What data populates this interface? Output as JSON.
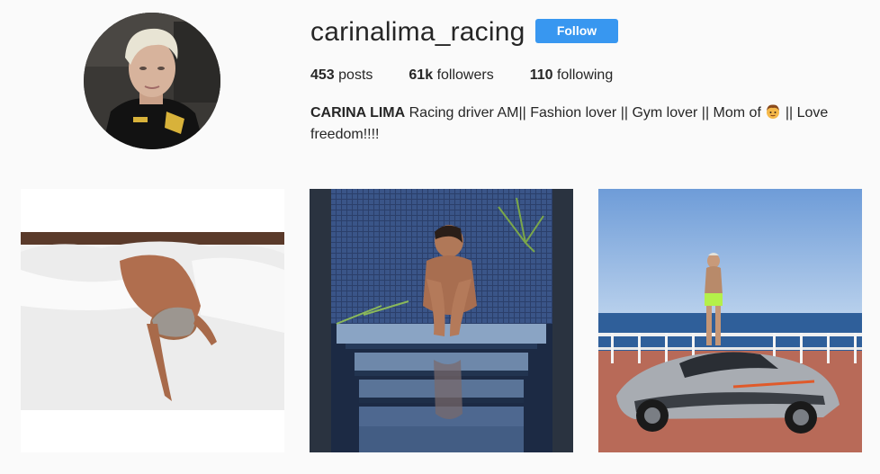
{
  "profile": {
    "username": "carinalima_racing",
    "follow_label": "Follow",
    "stats": {
      "posts_count": "453",
      "posts_label": "posts",
      "followers_count": "61k",
      "followers_label": "followers",
      "following_count": "110",
      "following_label": "following"
    },
    "bio": {
      "name": "CARINA LIMA",
      "text_before_emoji": "Racing driver AM|| Fashion lover || Gym lover || Mom of",
      "emoji_icon": "boy-face-emoji",
      "text_after_emoji": "|| Love freedom!!!!"
    }
  },
  "posts": [
    {
      "icon": "photo-woman-lying-on-bed"
    },
    {
      "icon": "photo-woman-sitting-in-mosaic-pool"
    },
    {
      "icon": "photo-woman-standing-on-supercar"
    }
  ],
  "colors": {
    "follow_button": "#3897f0",
    "background": "#fafafa",
    "text": "#262626"
  }
}
